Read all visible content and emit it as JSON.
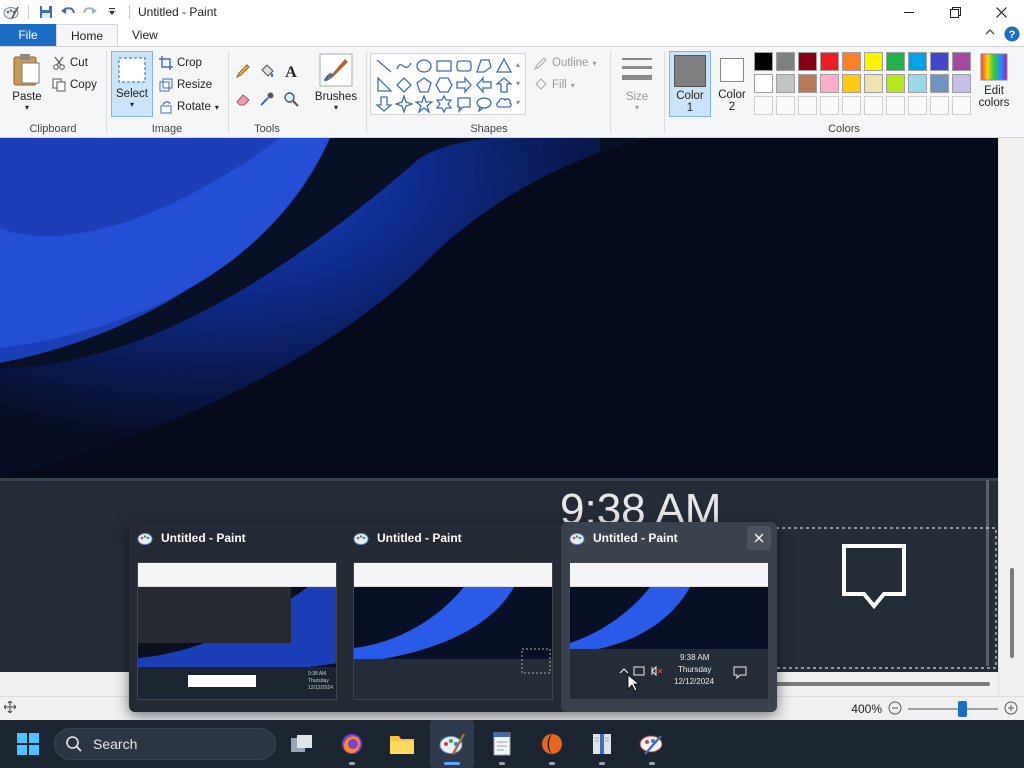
{
  "window": {
    "title": "Untitled - Paint"
  },
  "tabs": {
    "file": "File",
    "home": "Home",
    "view": "View"
  },
  "ribbon": {
    "clipboard": {
      "label": "Clipboard",
      "paste": "Paste",
      "cut": "Cut",
      "copy": "Copy"
    },
    "image": {
      "label": "Image",
      "select": "Select",
      "crop": "Crop",
      "resize": "Resize",
      "rotate": "Rotate"
    },
    "tools": {
      "label": "Tools"
    },
    "brushes": {
      "label": "Brushes"
    },
    "shapes": {
      "label": "Shapes",
      "outline": "Outline",
      "fill": "Fill"
    },
    "size": {
      "label": "Size"
    },
    "colors": {
      "label": "Colors",
      "color1": "Color\n1",
      "color1_a": "Color",
      "color1_b": "1",
      "color2_a": "Color",
      "color2_b": "2",
      "edit_a": "Edit",
      "edit_b": "colors",
      "color1_value": "#7f7f7f",
      "color2_value": "#ffffff",
      "palette_row1": [
        "#000000",
        "#7f7f7f",
        "#880015",
        "#ed1c24",
        "#ff7f27",
        "#fff200",
        "#22b14c",
        "#00a2e8",
        "#3f48cc",
        "#a349a4"
      ],
      "palette_row2": [
        "#ffffff",
        "#c3c3c3",
        "#b97a57",
        "#ffaec9",
        "#ffc90e",
        "#efe4b0",
        "#b5e61d",
        "#99d9ea",
        "#7092be",
        "#c8bfe7"
      ]
    }
  },
  "canvas_content": {
    "clock_time": "9:38 AM"
  },
  "statusbar": {
    "zoom": "400%",
    "zoom_level": 0.6
  },
  "taskbar": {
    "search_placeholder": "Search"
  },
  "thumbnails": [
    {
      "title": "Untitled - Paint",
      "mini_time": "9:38 AM",
      "mini_day": "Thursday",
      "mini_date": "12/12/2024"
    },
    {
      "title": "Untitled - Paint"
    },
    {
      "title": "Untitled - Paint",
      "mini_time": "9:38 AM",
      "mini_day": "Thursday",
      "mini_date": "12/12/2024"
    }
  ]
}
